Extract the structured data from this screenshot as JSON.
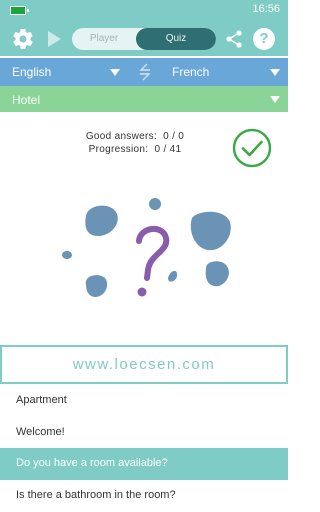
{
  "status_bar": {
    "time": "16:56",
    "icons": {
      "battery": "battery-icon"
    }
  },
  "toolbar": {
    "icons": {
      "settings": "gear-icon",
      "play": "play-icon",
      "share": "share-icon"
    },
    "mode_player": "Player",
    "mode_quiz": "Quiz",
    "selected_mode": "Quiz",
    "help": "?"
  },
  "language_bar": {
    "source": "English",
    "target": "French",
    "icons": {
      "swap": "swap-icon",
      "dropdown": "chevron-down-icon"
    }
  },
  "topic_bar": {
    "topic": "Hotel"
  },
  "quiz": {
    "good_answers_label": "Good answers:",
    "good_answers_value": "0 / 0",
    "progression_label": "Progression:",
    "progression_value": "0 / 41",
    "illustration": "question-mark-illustration",
    "validate_icon": "checkmark-icon"
  },
  "brand": {
    "text": "www.loecsen.com"
  },
  "answers": [
    {
      "label": "Apartment"
    },
    {
      "label": "Welcome!"
    },
    {
      "label": "Do you have a room available?"
    },
    {
      "label": "Is there a bathroom in the room?"
    }
  ],
  "colors": {
    "accent": "#7fcbc5",
    "language_bar": "#6aa7d9",
    "topic_bar": "#8bd497",
    "quiz_toggle": "#2f6e73",
    "question_mark": "#8a5cae",
    "blob": "#6b93b6"
  }
}
